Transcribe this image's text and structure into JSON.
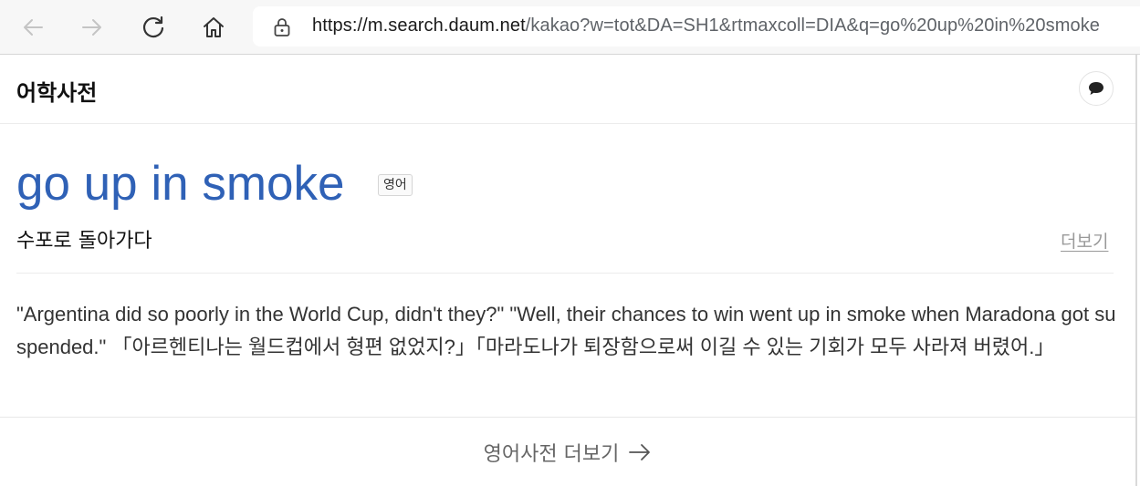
{
  "browser": {
    "url_host": "https://m.search.daum.net",
    "url_rest": "/kakao?w=tot&DA=SH1&rtmaxcoll=DIA&q=go%20up%20in%20smoke"
  },
  "header": {
    "title": "어학사전"
  },
  "entry": {
    "word": "go up in smoke",
    "language_badge": "영어",
    "meaning": "수포로 돌아가다",
    "more_label": "더보기"
  },
  "example": {
    "text": "\"Argentina did so poorly in the World Cup, didn't they?\" \"Well, their chances to win went up in smoke when Maradona got suspended.\" 「아르헨티나는 월드컵에서 형편 없었지?」「마라도나가 퇴장함으로써 이길 수 있는 기회가 모두 사라져 버렸어.」"
  },
  "footer": {
    "more_label": "영어사전 더보기"
  },
  "colors": {
    "word": "#2f61b6",
    "chrome_bg": "#f7f7f7"
  }
}
